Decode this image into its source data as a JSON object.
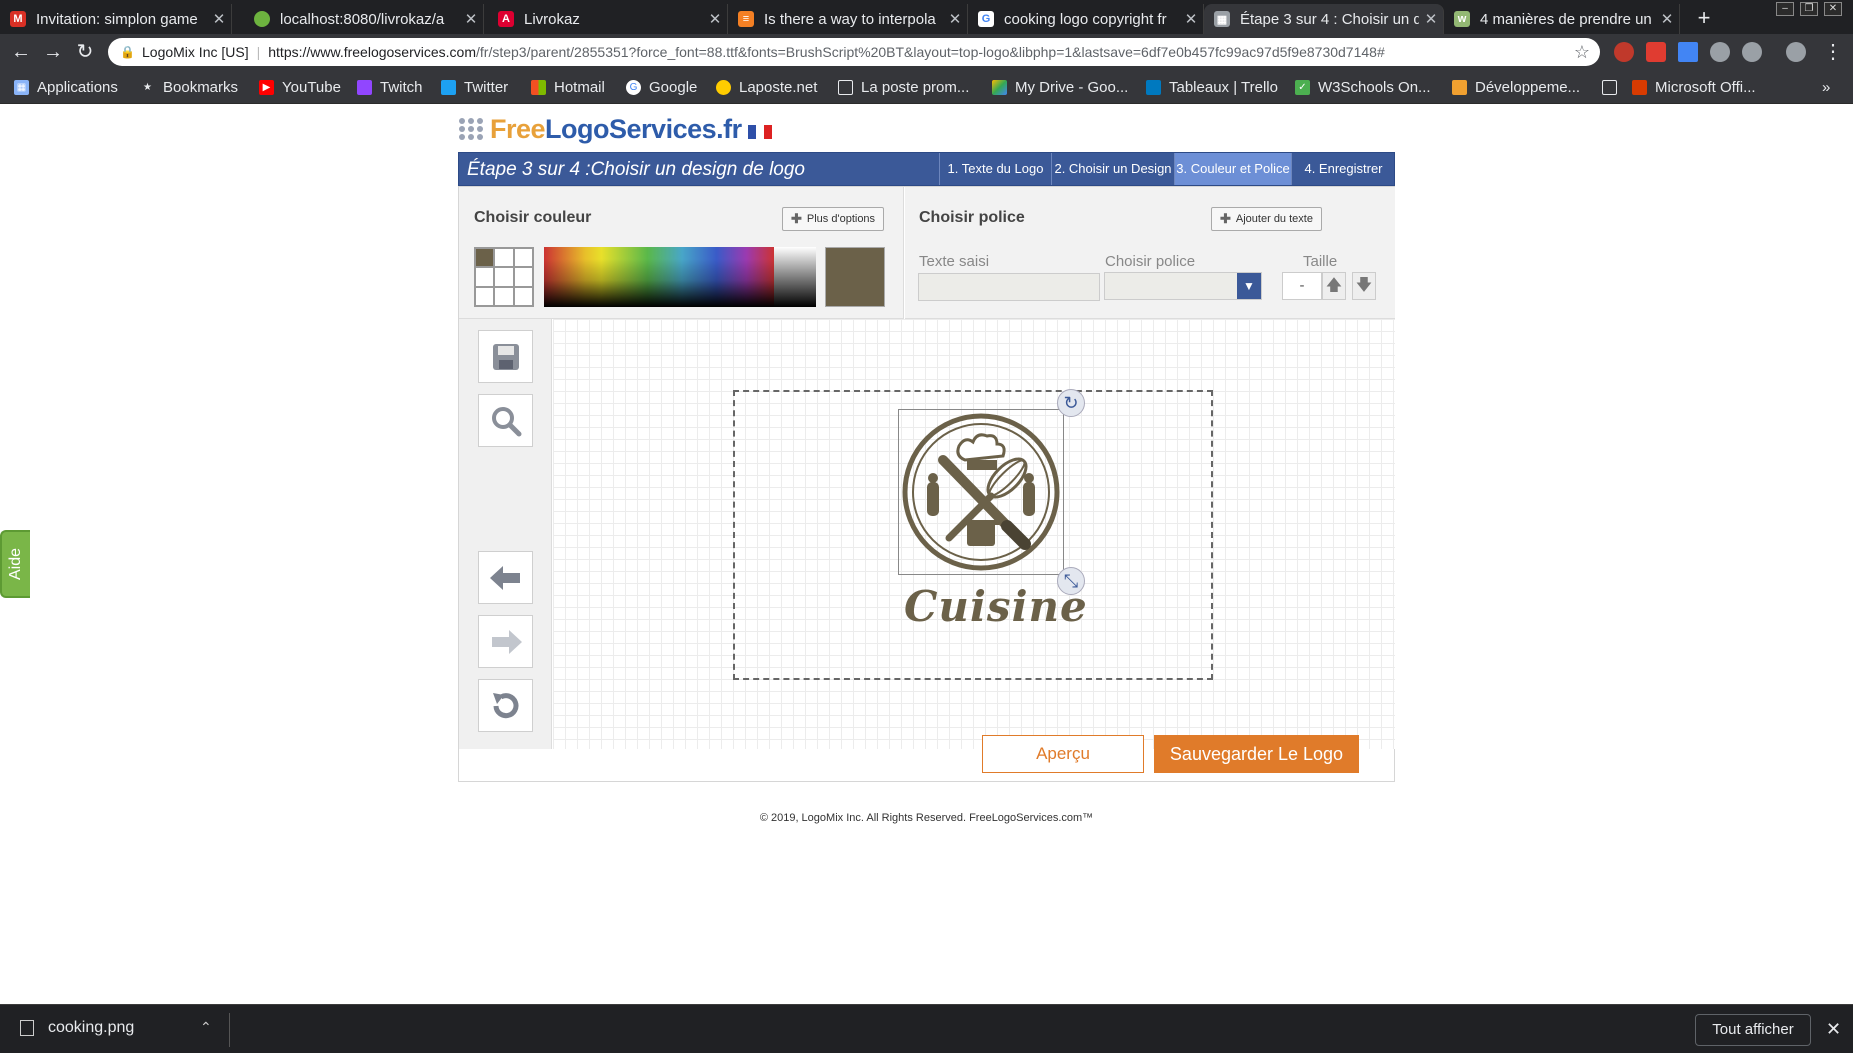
{
  "browser": {
    "tabs": [
      {
        "title": "Invitation: simplon game",
        "icon": "gmail-icon",
        "color": "#d93025"
      },
      {
        "title": "localhost:8080/livrokaz/a",
        "icon": "spring-leaf-icon",
        "color": "#6db33f"
      },
      {
        "title": "Livrokaz",
        "icon": "angular-icon",
        "color": "#dd0031"
      },
      {
        "title": "Is there a way to interpola",
        "icon": "stackoverflow-icon",
        "color": "#f48024"
      },
      {
        "title": "cooking logo copyright fr",
        "icon": "google-icon",
        "color": "#4285f4"
      },
      {
        "title": "Étape 3 sur 4 : Choisir un d",
        "icon": "grid-icon",
        "color": "#9aa0a6"
      },
      {
        "title": "4 manières de prendre un",
        "icon": "wikihow-icon",
        "color": "#93b874"
      }
    ],
    "new_tab": "+",
    "omnibox": {
      "org": "LogoMix Inc [US]",
      "host": "https://www.freelogoservices.com",
      "path": "/fr/step3/parent/2855351?force_font=88.ttf&fonts=BrushScript%20BT&layout=top-logo&libphp=1&lastsave=6df7e0b457fc99ac97d5f9e8730d7148#"
    },
    "bookmarks": [
      {
        "label": "Applications",
        "icon": "apps-grid-icon",
        "color": "#8ab4f8"
      },
      {
        "label": "Bookmarks",
        "icon": "star-icon",
        "color": "#e8eaed"
      },
      {
        "label": "YouTube",
        "icon": "youtube-icon",
        "color": "#ff0000"
      },
      {
        "label": "Twitch",
        "icon": "twitch-icon",
        "color": "#9146ff"
      },
      {
        "label": "Twitter",
        "icon": "twitter-icon",
        "color": "#1da1f2"
      },
      {
        "label": "Hotmail",
        "icon": "windows-icon",
        "color": "#f25022"
      },
      {
        "label": "Google",
        "icon": "google-icon",
        "color": "#e8eaed"
      },
      {
        "label": "Laposte.net",
        "icon": "laposte-icon",
        "color": "#ffcc00"
      },
      {
        "label": "La poste prom...",
        "icon": "page-icon",
        "color": "#e8eaed"
      },
      {
        "label": "My Drive - Goo...",
        "icon": "drive-icon",
        "color": "#34a853"
      },
      {
        "label": "Tableaux | Trello",
        "icon": "trello-icon",
        "color": "#0079bf"
      },
      {
        "label": "W3Schools On...",
        "icon": "w3schools-icon",
        "color": "#4caf50"
      },
      {
        "label": "Développeme...",
        "icon": "box-icon",
        "color": "#f0a030"
      },
      {
        "label": "",
        "icon": "page-icon",
        "color": "#e8eaed"
      },
      {
        "label": "Microsoft Offi...",
        "icon": "office-icon",
        "color": "#d83b01"
      }
    ],
    "more_bookmarks": "»"
  },
  "site": {
    "logo_free": "Free",
    "logo_rest": "LogoServices.fr",
    "step_title": "Étape 3 sur 4 :Choisir un design de logo",
    "steps": [
      "1. Texte du Logo",
      "2. Choisir un Design",
      "3. Couleur et Police",
      "4. Enregistrer"
    ],
    "current_step": 2
  },
  "color_panel": {
    "heading": "Choisir couleur",
    "more_options": "Plus d'options",
    "current_color": "#6b6149"
  },
  "font_panel": {
    "heading": "Choisir police",
    "add_text": "Ajouter du texte",
    "text_label": "Texte saisi",
    "text_value": "",
    "font_label": "Choisir police",
    "font_value": "",
    "size_label": "Taille",
    "size_value": "-"
  },
  "canvas": {
    "logo_text": "Cuisine",
    "logo_color": "#6b6149"
  },
  "actions": {
    "preview": "Aperçu",
    "save": "Sauvegarder Le Logo"
  },
  "footer": "© 2019, LogoMix Inc. All Rights Reserved. FreeLogoServices.com™",
  "help_tab": "Aide",
  "download_bar": {
    "file": "cooking.png",
    "show_all": "Tout afficher"
  }
}
